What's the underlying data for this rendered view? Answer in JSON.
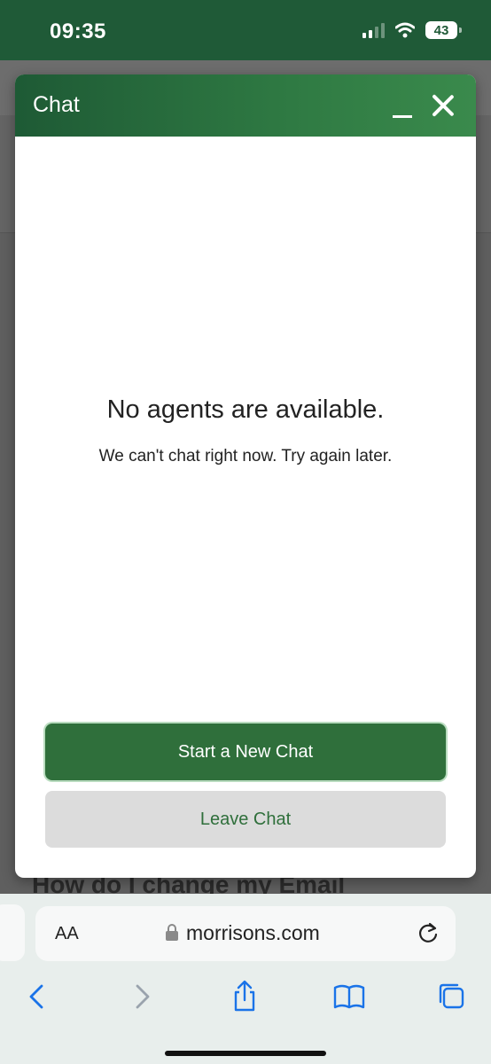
{
  "status_bar": {
    "time": "09:35",
    "battery": "43"
  },
  "website": {
    "heading_peek": "How do I change my Email"
  },
  "chat": {
    "title": "Chat",
    "message_title": "No agents are available.",
    "message_subtitle": "We can't chat right now. Try again later.",
    "start_button": "Start a New Chat",
    "leave_button": "Leave Chat"
  },
  "browser": {
    "text_size_label": "AA",
    "url": "morrisons.com",
    "toolbar": [
      "back-icon",
      "forward-icon",
      "share-icon",
      "bookmarks-icon",
      "tabs-icon"
    ]
  },
  "colors": {
    "brand_green": "#2f6f3b",
    "header_green": "#1f5a37",
    "ios_blue": "#1a73e8"
  }
}
